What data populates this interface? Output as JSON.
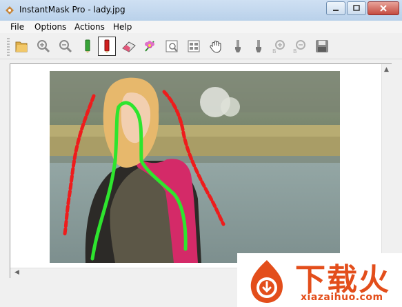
{
  "window": {
    "title": "InstantMask Pro - lady.jpg"
  },
  "menu": {
    "items": [
      "File",
      "Options",
      "Actions",
      "Help"
    ]
  },
  "toolbar": {
    "tools": [
      "open-folder-icon",
      "zoom-in-icon",
      "zoom-out-icon",
      "green-pencil-icon",
      "red-pencil-icon",
      "eraser-icon",
      "flower-icon",
      "preview-icon",
      "grid-view-icon",
      "hand-icon",
      "brush-icon",
      "brush-2-icon",
      "zoom-in-b-icon",
      "zoom-out-b-icon",
      "save-icon"
    ],
    "active_tool": "red-pencil-icon"
  },
  "watermark": {
    "chinese_text": "下载火",
    "url": "xiazaihuo.com"
  },
  "colors": {
    "foreground_stroke": "#2ee52e",
    "background_stroke": "#ee1c1c",
    "accent": "#e34e1b"
  }
}
